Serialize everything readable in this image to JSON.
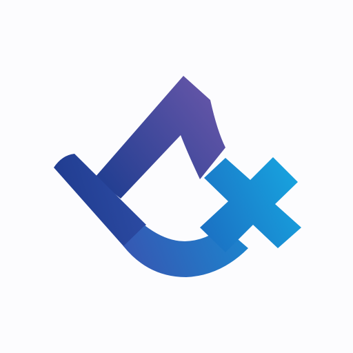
{
  "logo": {
    "icon": "logo-mark-icon",
    "colors": {
      "background": "#fcfcfe",
      "deep_blue": "#1f3a8d",
      "mid_blue": "#2f5fb6",
      "violet": "#6c58aa",
      "cyan": "#1aa1df"
    }
  }
}
